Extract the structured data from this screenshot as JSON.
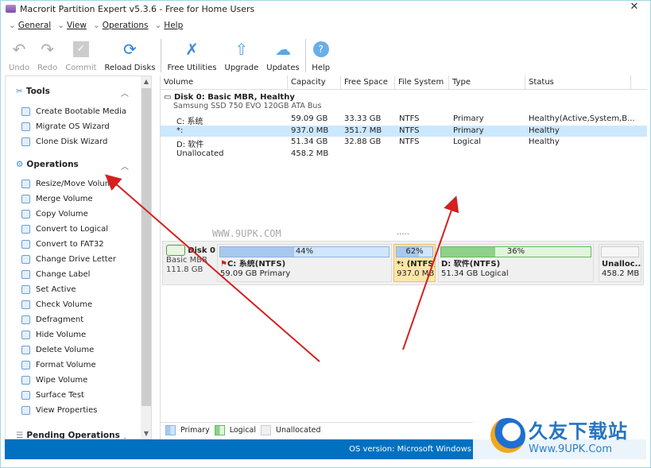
{
  "window": {
    "title": "Macrorit Partition Expert v5.3.6 - Free for Home Users",
    "close": "✕"
  },
  "menu": [
    {
      "label": "General"
    },
    {
      "label": "View"
    },
    {
      "label": "Operations"
    },
    {
      "label": "Help"
    }
  ],
  "toolbar": [
    {
      "label": "Undo",
      "icon": "undo-icon",
      "enabled": false
    },
    {
      "label": "Redo",
      "icon": "redo-icon",
      "enabled": false
    },
    {
      "label": "Commit",
      "icon": "commit-icon",
      "enabled": false
    },
    {
      "label": "Reload Disks",
      "icon": "reload-icon",
      "enabled": true
    },
    {
      "label": "Free Utilities",
      "icon": "utilities-icon",
      "enabled": true
    },
    {
      "label": "Upgrade",
      "icon": "upgrade-icon",
      "enabled": true
    },
    {
      "label": "Updates",
      "icon": "updates-icon",
      "enabled": true
    },
    {
      "label": "Help",
      "icon": "help-icon",
      "enabled": true
    }
  ],
  "sidebar": {
    "tools_title": "Tools",
    "tools": [
      "Create Bootable Media",
      "Migrate OS Wizard",
      "Clone Disk Wizard"
    ],
    "operations_title": "Operations",
    "operations": [
      "Resize/Move Volume",
      "Merge Volume",
      "Copy Volume",
      "Convert to Logical",
      "Convert to FAT32",
      "Change Drive Letter",
      "Change Label",
      "Set Active",
      "Check Volume",
      "Defragment",
      "Hide Volume",
      "Delete Volume",
      "Format Volume",
      "Wipe Volume",
      "Surface Test",
      "View Properties"
    ],
    "pending_title": "Pending Operations"
  },
  "table": {
    "columns": [
      "Volume",
      "Capacity",
      "Free Space",
      "File System",
      "Type",
      "Status"
    ],
    "disk_header": "Disk 0: Basic MBR, Healthy",
    "disk_model": "Samsung SSD 750 EVO 120GB ATA Bus",
    "rows": [
      {
        "volume": "C: 系统",
        "capacity": "59.09 GB",
        "free": "33.33 GB",
        "fs": "NTFS",
        "type": "Primary",
        "status": "Healthy(Active,System,B..."
      },
      {
        "volume": "*:",
        "capacity": "937.0 MB",
        "free": "351.7 MB",
        "fs": "NTFS",
        "type": "Primary",
        "status": "Healthy",
        "selected": true
      },
      {
        "volume": "D: 软件",
        "capacity": "51.34 GB",
        "free": "32.88 GB",
        "fs": "NTFS",
        "type": "Logical",
        "status": "Healthy"
      },
      {
        "volume": "Unallocated",
        "capacity": "458.2 MB",
        "free": "",
        "fs": "",
        "type": "",
        "status": ""
      }
    ]
  },
  "watermark": "WWW.9UPK.COM",
  "dots": ".....",
  "diskmap": {
    "disk_name": "Disk 0",
    "disk_type": "Basic MBR",
    "disk_size": "111.8 GB",
    "partitions": [
      {
        "pct": "44%",
        "used": 44,
        "name": "C: 系统(NTFS)",
        "info": "59.09 GB Primary",
        "kind": "primary"
      },
      {
        "pct": "62%",
        "used": 62,
        "name": "*: (NTFS)",
        "info": "937.0 MB",
        "kind": "primary",
        "selected": true
      },
      {
        "pct": "36%",
        "used": 36,
        "name": "D: 软件(NTFS)",
        "info": "51.34 GB Logical",
        "kind": "logical"
      },
      {
        "pct": "",
        "used": 0,
        "name": "Unalloc...",
        "info": "458.2 MB",
        "kind": "unallocated"
      }
    ]
  },
  "legend": [
    "Primary",
    "Logical",
    "Unallocated"
  ],
  "status": {
    "os": "OS version: Microsoft Windows"
  },
  "logo": {
    "cn": "久友下载站",
    "url": "Www.9UPK.Com"
  },
  "colors": {
    "statusbar": "#0070c0",
    "selected": "#cce8ff",
    "primary": "#a9c8ee",
    "logical": "#8fd08a",
    "arrow": "#d42020"
  }
}
